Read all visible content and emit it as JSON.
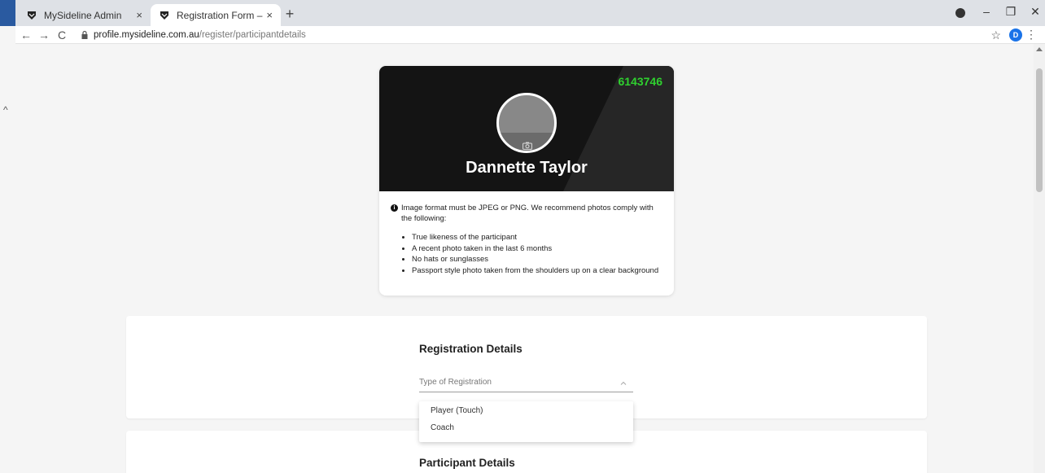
{
  "browser": {
    "tabs": [
      {
        "title": "MySideline Admin",
        "close": "×"
      },
      {
        "title": "Registration Form – MySideline",
        "close": "×"
      }
    ],
    "new_tab": "+",
    "window_controls": {
      "minimize": "–",
      "restore": "❐",
      "close": "✕"
    },
    "url_domain": "profile.mysideline.com.au",
    "url_path": "/register/participantdetails",
    "avatar_letter": "D",
    "nav": {
      "back": "←",
      "forward": "→",
      "reload": "C"
    },
    "star": "☆",
    "menu": "⋮"
  },
  "side": {
    "collapse_chevron": "^"
  },
  "profile": {
    "member_id": "6143746",
    "name": "Dannette Taylor",
    "info_icon": "i",
    "note": "Image format must be JPEG or PNG. We recommend photos comply with the following:",
    "requirements": [
      "True likeness of the participant",
      "A recent photo taken in the last 6 months",
      "No hats or sunglasses",
      "Passport style photo taken from the shoulders up on a clear background"
    ],
    "colors": {
      "header_bg": "#141414",
      "member_id": "#2fd12f"
    }
  },
  "registration": {
    "title": "Registration Details",
    "type_placeholder": "Type of Registration",
    "options": [
      "Player (Touch)",
      "Coach"
    ]
  },
  "participant": {
    "title": "Participant Details"
  }
}
